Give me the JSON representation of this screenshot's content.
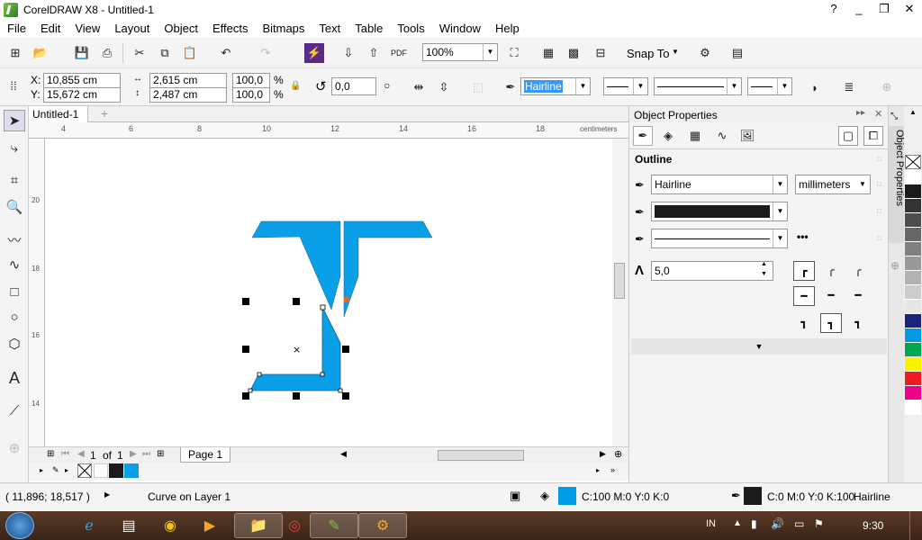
{
  "window": {
    "title": "CorelDRAW X8 - Untitled-1",
    "min": "_",
    "max": "❐",
    "close": "✕",
    "help_icon": "?"
  },
  "menu": [
    "File",
    "Edit",
    "View",
    "Layout",
    "Object",
    "Effects",
    "Bitmaps",
    "Text",
    "Table",
    "Tools",
    "Window",
    "Help"
  ],
  "toolbar": {
    "zoom": "100%",
    "snap": "Snap To",
    "pdf": "PDF"
  },
  "propbar": {
    "x_label": "X:",
    "x": "10,855 cm",
    "y_label": "Y:",
    "y": "15,672 cm",
    "w": "2,615 cm",
    "h": "2,487 cm",
    "sx": "100,0",
    "sy": "100,0",
    "pct": "%",
    "angle": "0,0",
    "outline": "Hairline"
  },
  "doc": {
    "tab": "Untitled-1",
    "plus": "+"
  },
  "ruler": {
    "h_ticks": [
      "4",
      "6",
      "8",
      "10",
      "12",
      "14",
      "16",
      "18"
    ],
    "units": "centimeters",
    "v_ticks": [
      "20",
      "18",
      "16",
      "14"
    ]
  },
  "pager": {
    "page": "1",
    "of": "of",
    "total": "1",
    "page_tab": "Page 1"
  },
  "panel": {
    "title": "Object Properties",
    "section": "Outline",
    "width": "Hairline",
    "units": "millimeters",
    "miter": "5,0",
    "vtab": "Object Properties",
    "color": "#1a1a1a"
  },
  "status": {
    "coords": "( 11,896; 18,517 )",
    "object": "Curve on Layer 1",
    "fill_value": "C:100 M:0 Y:0 K:0",
    "fill_color": "#0099e6",
    "outline_value": "C:0 M:0 Y:0 K:100",
    "outline_width": "Hairline",
    "outline_color": "#1a1a1a"
  },
  "taskbar": {
    "lang": "IN",
    "time": "9:30"
  },
  "shape_fill": "#0aa0e8",
  "palette": [
    "#ffffff",
    "#1a1a1a",
    "#333333",
    "#4d4d4d",
    "#666666",
    "#808080",
    "#999999",
    "#b3b3b3",
    "#cccccc",
    "#e6e6e6",
    "#1a237e",
    "#0099e6",
    "#00a651",
    "#fff200",
    "#ed1c24",
    "#ec008c",
    "#ffffff"
  ]
}
